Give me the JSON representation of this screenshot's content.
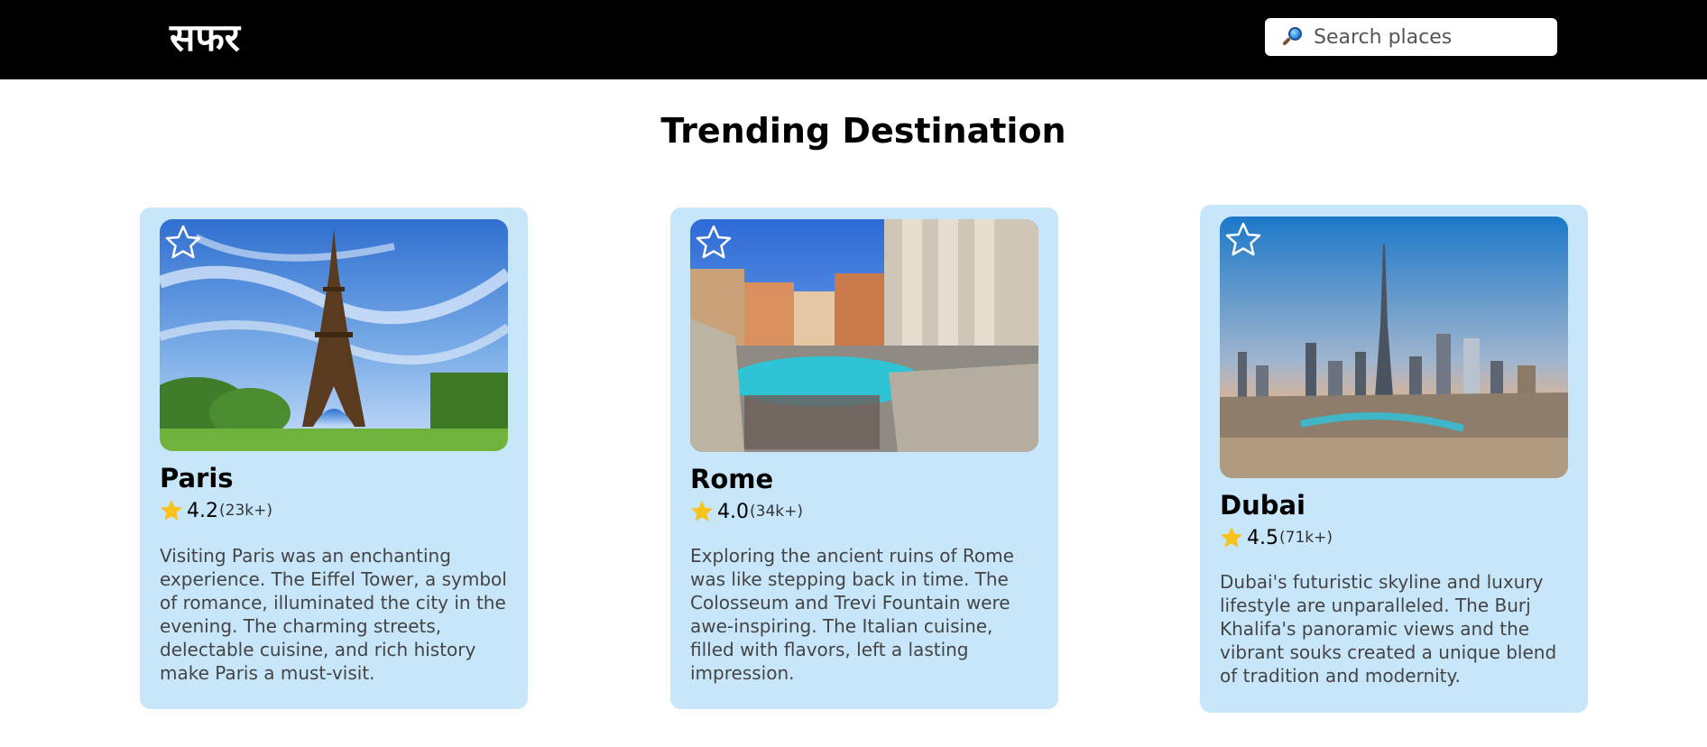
{
  "header": {
    "logo": "सफर",
    "search": {
      "placeholder": "Search places",
      "value": "",
      "icon": "magnifying-glass-icon"
    }
  },
  "main": {
    "title": "Trending Destination",
    "cards": [
      {
        "name": "Paris",
        "image": "eiffel-tower-photo",
        "rating": "4.2",
        "reviews": "(23k+)",
        "description": "Visiting Paris was an enchanting experience. The Eiffel Tower, a symbol of romance, illuminated the city in the evening. The charming streets, delectable cuisine, and rich history make Paris a must-visit."
      },
      {
        "name": "Rome",
        "image": "trevi-fountain-photo",
        "rating": "4.0",
        "reviews": "(34k+)",
        "description": "Exploring the ancient ruins of Rome was like stepping back in time. The Colosseum and Trevi Fountain were awe-inspiring. The Italian cuisine, filled with flavors, left a lasting impression."
      },
      {
        "name": "Dubai",
        "image": "dubai-skyline-photo",
        "rating": "4.5",
        "reviews": "(71k+)",
        "description": "Dubai's futuristic skyline and luxury lifestyle are unparalleled. The Burj Khalifa's panoramic views and the vibrant souks created a unique blend of tradition and modernity."
      }
    ]
  },
  "colors": {
    "header_bg": "#000000",
    "card_bg": "#c8e6fa",
    "star_fill": "#f7c21b"
  }
}
